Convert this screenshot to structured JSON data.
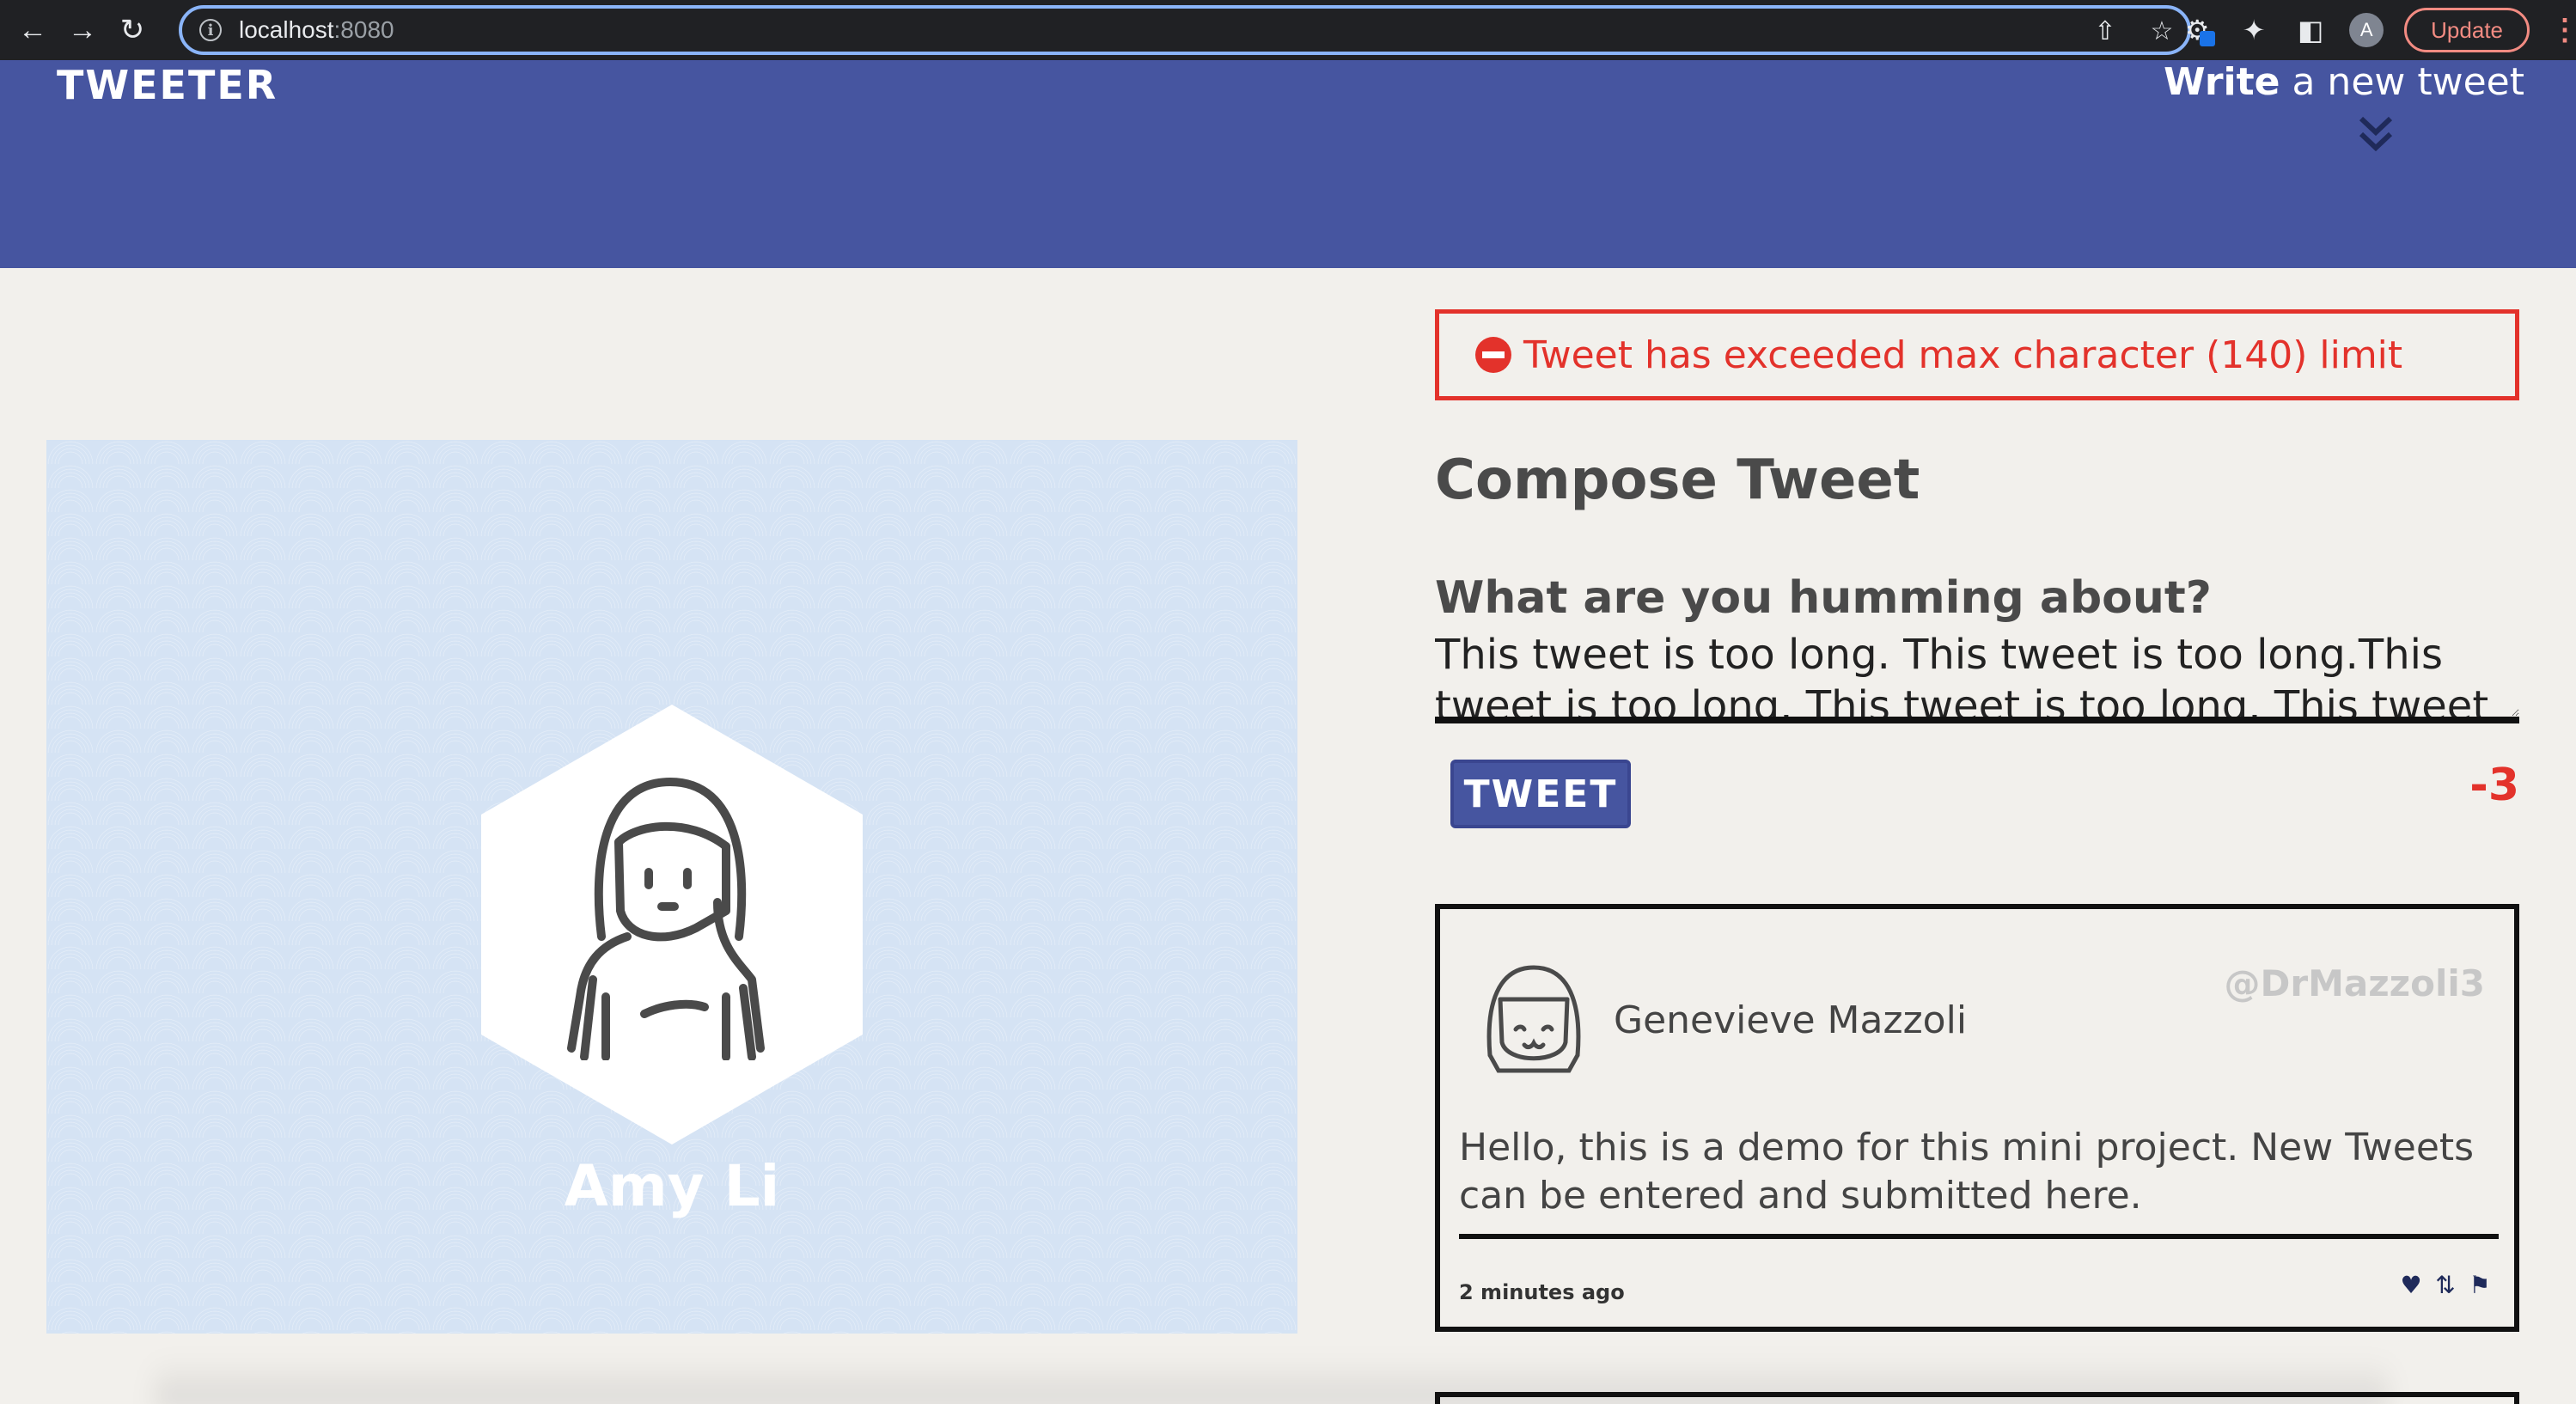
{
  "browser": {
    "url_host": "localhost",
    "url_port": ":8080",
    "profile_initial": "A",
    "update_label": "Update"
  },
  "header": {
    "logo": "TWEETER",
    "write_bold": "Write",
    "write_rest": " a new tweet"
  },
  "profile": {
    "name": "Amy Li"
  },
  "compose": {
    "error_message": "Tweet has exceeded max character (140) limit",
    "title": "Compose Tweet",
    "prompt": "What are you humming about?",
    "textarea_value": "This tweet is too long. This tweet is too long.This tweet is too long. This tweet is too long. This tweet is too",
    "button_label": "TWEET",
    "counter": "-3"
  },
  "tweets": [
    {
      "name": "Genevieve Mazzoli",
      "handle": "@DrMazzoli3",
      "body": "Hello, this is a demo for this mini project. New Tweets can be entered and submitted here.",
      "time": "2 minutes ago"
    }
  ],
  "colors": {
    "header_bg": "#4655a0",
    "error": "#e3322b",
    "page_bg": "#f2f0ec"
  },
  "icons": {
    "tweet_actions": [
      "heart-icon",
      "retweet-icon",
      "flag-icon"
    ]
  }
}
